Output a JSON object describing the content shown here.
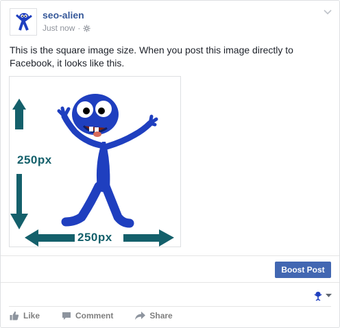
{
  "post": {
    "page_name": "seo-alien",
    "timestamp": "Just now",
    "separator": "·",
    "text": "This is the square image size. When you post this image directly to Facebook, it looks like this.",
    "image": {
      "height_label": "250px",
      "width_label": "250px",
      "arrow_color": "#14606b",
      "alien_color": "#1f3fbf"
    }
  },
  "boost": {
    "label": "Boost Post"
  },
  "actions": [
    {
      "label": "Like",
      "icon": "thumbs-up-icon"
    },
    {
      "label": "Comment",
      "icon": "comment-icon"
    },
    {
      "label": "Share",
      "icon": "share-icon"
    }
  ],
  "colors": {
    "link": "#365899",
    "button": "#4267b2",
    "muted": "#90949c"
  }
}
